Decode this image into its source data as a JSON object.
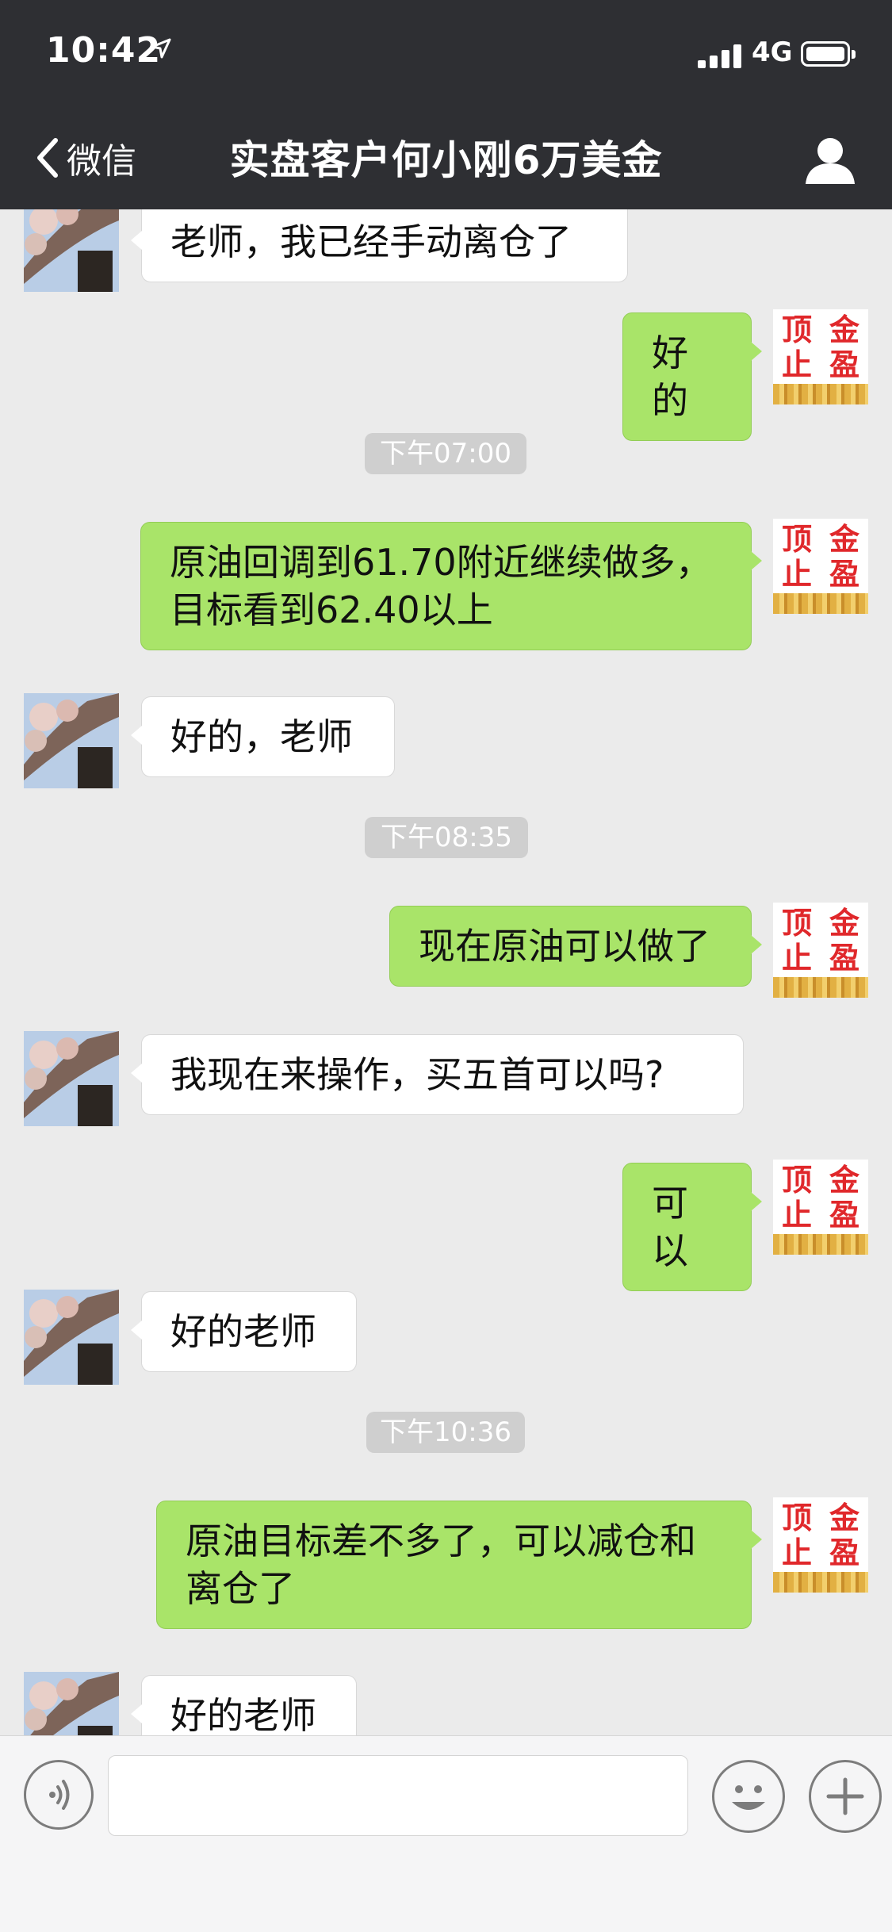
{
  "status_bar": {
    "time": "10:42",
    "network": "4G"
  },
  "nav": {
    "back_label": "微信",
    "title": "实盘客户何小刚6万美金"
  },
  "stamp_glyphs": [
    "顶",
    "金",
    "止",
    "盈"
  ],
  "messages": [
    {
      "side": "in",
      "text": "老师，我已经手动离仓了"
    },
    {
      "side": "out",
      "text": "好的"
    },
    {
      "timestamp": "下午07:00"
    },
    {
      "side": "out",
      "text": "原油回调到61.70附近继续做多，\n目标看到62.40以上"
    },
    {
      "side": "in",
      "text": "好的，老师"
    },
    {
      "timestamp": "下午08:35"
    },
    {
      "side": "out",
      "text": "现在原油可以做了"
    },
    {
      "side": "in",
      "text": "我现在来操作，买五首可以吗?"
    },
    {
      "side": "out",
      "text": "可以"
    },
    {
      "side": "in",
      "text": "好的老师"
    },
    {
      "timestamp": "下午10:36"
    },
    {
      "side": "out",
      "text": "原油目标差不多了，可以减仓和\n离仓了"
    },
    {
      "side": "in",
      "text": "好的老师"
    }
  ],
  "input": {
    "value": "",
    "placeholder": ""
  },
  "icons": {
    "back": "chevron-left-icon",
    "contact": "person-icon",
    "voice": "voice-icon",
    "emoji": "emoji-icon",
    "more": "plus-icon",
    "location": "location-arrow-icon"
  },
  "colors": {
    "header_bg": "#2e2f33",
    "chat_bg": "#ebebeb",
    "outgoing_bubble": "#a9e469",
    "incoming_bubble": "#ffffff",
    "timestamp_bg": "#cfcfcf"
  }
}
